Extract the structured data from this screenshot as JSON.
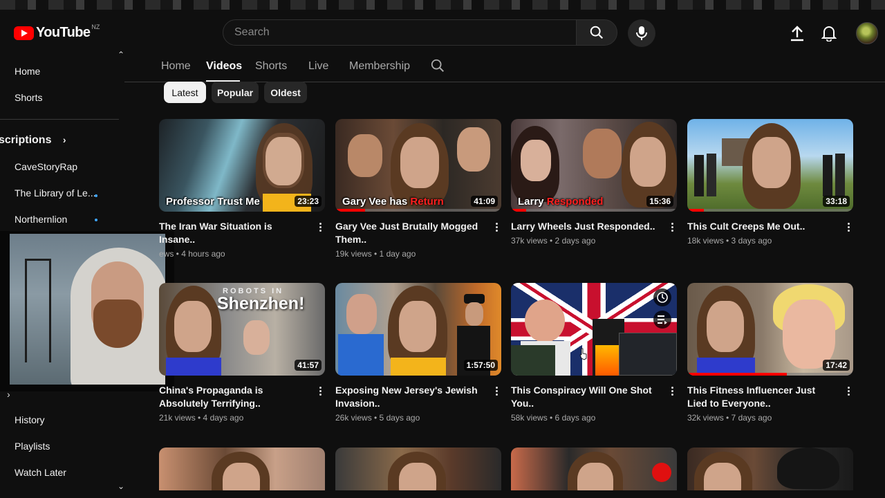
{
  "brand": {
    "name": "YouTube",
    "country": "NZ",
    "accent": "#ff0000"
  },
  "search": {
    "placeholder": "Search"
  },
  "header_icons": [
    "search-icon",
    "microphone-icon",
    "upload-icon",
    "bell-icon",
    "avatar"
  ],
  "sidebar": {
    "top_items": [
      {
        "label": "Home"
      },
      {
        "label": "Shorts"
      }
    ],
    "subscriptions_heading": "scriptions",
    "subscriptions": [
      {
        "label": "CaveStoryRap",
        "new": false
      },
      {
        "label": "The Library of Le...",
        "new": true
      },
      {
        "label": "Northernlion",
        "new": true
      }
    ],
    "you_items": [
      {
        "label": "History"
      },
      {
        "label": "Playlists"
      },
      {
        "label": "Watch Later"
      }
    ]
  },
  "tabs": [
    {
      "label": "Home",
      "active": false
    },
    {
      "label": "Videos",
      "active": true
    },
    {
      "label": "Shorts",
      "active": false
    },
    {
      "label": "Live",
      "active": false
    },
    {
      "label": "Membership",
      "active": false
    }
  ],
  "chips": [
    {
      "label": "Latest",
      "active": true
    },
    {
      "label": "Popular",
      "active": false
    },
    {
      "label": "Oldest",
      "active": false
    }
  ],
  "videos": [
    {
      "title": "The Iran War Situation is Insane..",
      "meta": "ews • 4 hours ago",
      "duration": "23:23",
      "thumb_text": "Professor Trust Me",
      "thumb_text_red": ""
    },
    {
      "title": "Gary Vee Just Brutally Mogged Them..",
      "meta": "19k views • 1 day ago",
      "duration": "41:09",
      "thumb_text": "Gary Vee has ",
      "thumb_text_red": "Return",
      "progress": 0.18
    },
    {
      "title": "Larry Wheels Just Responded..",
      "meta": "37k views • 2 days ago",
      "duration": "15:36",
      "thumb_text": "Larry ",
      "thumb_text_red": "Responded",
      "progress": 0.09
    },
    {
      "title": "This Cult Creeps Me Out..",
      "meta": "18k views • 3 days ago",
      "duration": "33:18",
      "thumb_text": "",
      "thumb_text_red": "",
      "progress": 0.1
    },
    {
      "title": "China's Propaganda is Absolutely Terrifying..",
      "meta": "21k views • 4 days ago",
      "duration": "41:57",
      "thumb_text": "Shenzhen!",
      "thumb_text_small": "ROBOTS IN"
    },
    {
      "title": "Exposing New Jersey's Jewish Invasion..",
      "meta": "26k views • 5 days ago",
      "duration": "1:57:50",
      "thumb_text": "",
      "thumb_text_red": ""
    },
    {
      "title": "This Conspiracy Will One Shot You..",
      "meta": "58k views • 6 days ago",
      "duration": "",
      "thumb_text": "",
      "thumb_text_red": ""
    },
    {
      "title": "This Fitness Influencer Just Lied to Everyone..",
      "meta": "32k views • 7 days ago",
      "duration": "17:42",
      "thumb_text": "",
      "thumb_text_red": "",
      "progress": 0.6
    }
  ]
}
